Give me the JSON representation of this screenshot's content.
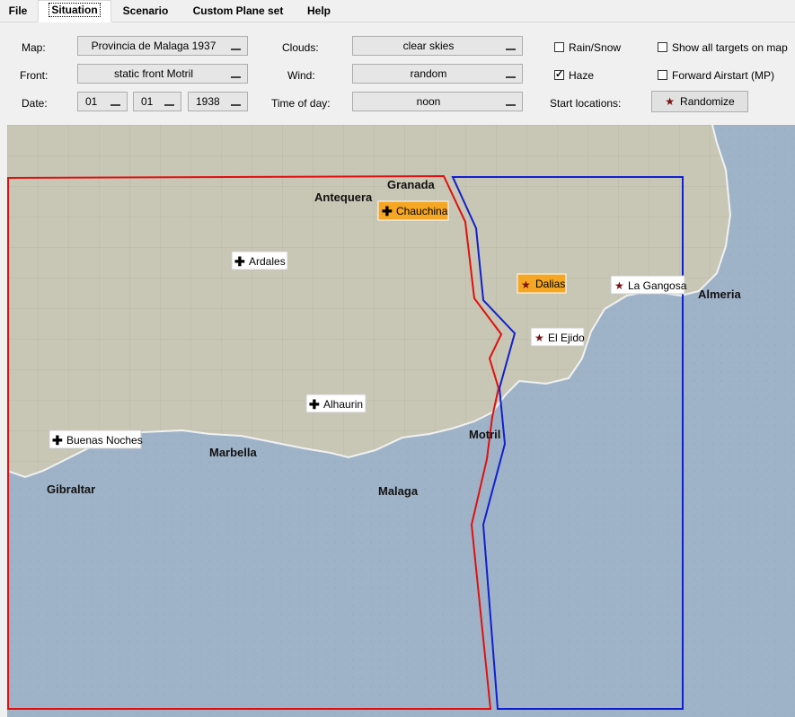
{
  "tabs": [
    {
      "label": "File",
      "active": false
    },
    {
      "label": "Situation",
      "active": true
    },
    {
      "label": "Scenario",
      "active": false
    },
    {
      "label": "Custom Plane set",
      "active": false
    },
    {
      "label": "Help",
      "active": false
    }
  ],
  "form": {
    "map_label": "Map:",
    "map_value": "Provincia de Malaga 1937",
    "front_label": "Front:",
    "front_value": "static front Motril",
    "date_label": "Date:",
    "date_day": "01",
    "date_month": "01",
    "date_year": "1938",
    "clouds_label": "Clouds:",
    "clouds_value": "clear skies",
    "wind_label": "Wind:",
    "wind_value": "random",
    "time_label": "Time of day:",
    "time_value": "noon",
    "rain_label": "Rain/Snow",
    "rain_checked": false,
    "haze_label": "Haze",
    "haze_checked": true,
    "show_targets_label": "Show all targets on map",
    "show_targets_checked": false,
    "forward_airstart_label": "Forward Airstart (MP)",
    "forward_airstart_checked": false,
    "start_locations_label": "Start locations:",
    "randomize_label": "Randomize"
  },
  "map": {
    "city_labels": [
      "Granada",
      "Antequera",
      "Almeria",
      "Marbella",
      "Gibraltar",
      "Motril",
      "Malaga"
    ],
    "red_airfields": [
      {
        "name": "Chauchina",
        "selected": true
      },
      {
        "name": "Ardales",
        "selected": false
      },
      {
        "name": "Alhaurin",
        "selected": false
      },
      {
        "name": "Buenas Noches",
        "selected": false
      }
    ],
    "blue_airfields": [
      {
        "name": "Dalias",
        "selected": true
      },
      {
        "name": "La Gangosa",
        "selected": false
      },
      {
        "name": "El Ejido",
        "selected": false
      }
    ],
    "colors": {
      "land": "#c8c6b4",
      "sea": "#9fb3c8",
      "red_front": "#e01010",
      "blue_front": "#1020d0",
      "selected_airfield": "#f5a623"
    }
  }
}
